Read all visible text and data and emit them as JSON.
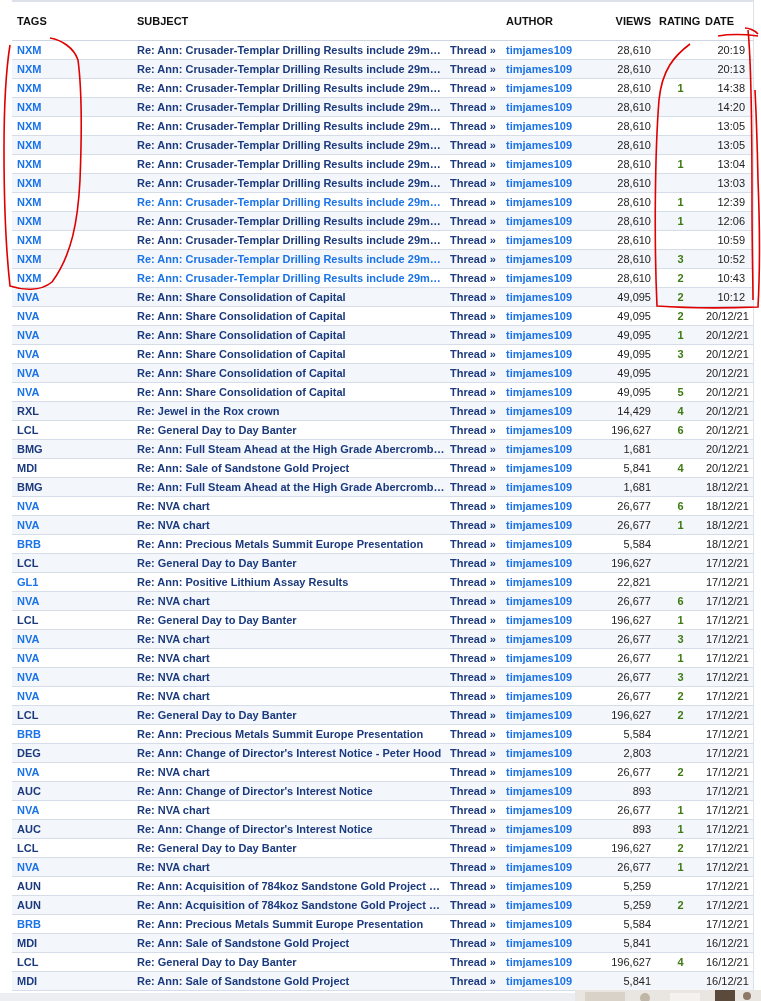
{
  "columns": [
    "TAGS",
    "SUBJECT",
    "AUTHOR",
    "VIEWS",
    "RATING",
    "DATE"
  ],
  "rows": [
    {
      "tag": "NXM",
      "tag_visited": false,
      "subject": "Re: Ann: Crusader-Templar Drilling Results include 29m…",
      "subject_visited": true,
      "thread": "Thread »",
      "author": "timjames109",
      "views": "28,610",
      "date": "20:19"
    },
    {
      "tag": "NXM",
      "tag_visited": false,
      "subject": "Re: Ann: Crusader-Templar Drilling Results include 29m…",
      "subject_visited": true,
      "thread": "Thread »",
      "author": "timjames109",
      "views": "28,610",
      "date": "20:13"
    },
    {
      "tag": "NXM",
      "tag_visited": false,
      "subject": "Re: Ann: Crusader-Templar Drilling Results include 29m…",
      "subject_visited": true,
      "thread": "Thread »",
      "author": "timjames109",
      "views": "28,610",
      "rating": "1",
      "date": "14:38"
    },
    {
      "tag": "NXM",
      "tag_visited": false,
      "subject": "Re: Ann: Crusader-Templar Drilling Results include 29m…",
      "subject_visited": true,
      "thread": "Thread »",
      "author": "timjames109",
      "views": "28,610",
      "date": "14:20"
    },
    {
      "tag": "NXM",
      "tag_visited": false,
      "subject": "Re: Ann: Crusader-Templar Drilling Results include 29m…",
      "subject_visited": true,
      "thread": "Thread »",
      "author": "timjames109",
      "views": "28,610",
      "date": "13:05"
    },
    {
      "tag": "NXM",
      "tag_visited": false,
      "subject": "Re: Ann: Crusader-Templar Drilling Results include 29m…",
      "subject_visited": true,
      "thread": "Thread »",
      "author": "timjames109",
      "views": "28,610",
      "date": "13:05"
    },
    {
      "tag": "NXM",
      "tag_visited": false,
      "subject": "Re: Ann: Crusader-Templar Drilling Results include 29m…",
      "subject_visited": true,
      "thread": "Thread »",
      "author": "timjames109",
      "views": "28,610",
      "rating": "1",
      "date": "13:04"
    },
    {
      "tag": "NXM",
      "tag_visited": false,
      "subject": "Re: Ann: Crusader-Templar Drilling Results include 29m…",
      "subject_visited": true,
      "thread": "Thread »",
      "author": "timjames109",
      "views": "28,610",
      "date": "13:03"
    },
    {
      "tag": "NXM",
      "tag_visited": false,
      "subject": "Re: Ann: Crusader-Templar Drilling Results include 29m…",
      "subject_visited": false,
      "thread": "Thread »",
      "author": "timjames109",
      "views": "28,610",
      "rating": "1",
      "date": "12:39"
    },
    {
      "tag": "NXM",
      "tag_visited": false,
      "subject": "Re: Ann: Crusader-Templar Drilling Results include 29m…",
      "subject_visited": true,
      "thread": "Thread »",
      "author": "timjames109",
      "views": "28,610",
      "rating": "1",
      "date": "12:06"
    },
    {
      "tag": "NXM",
      "tag_visited": false,
      "subject": "Re: Ann: Crusader-Templar Drilling Results include 29m…",
      "subject_visited": true,
      "thread": "Thread »",
      "author": "timjames109",
      "views": "28,610",
      "date": "10:59"
    },
    {
      "tag": "NXM",
      "tag_visited": false,
      "subject": "Re: Ann: Crusader-Templar Drilling Results include 29m…",
      "subject_visited": false,
      "thread": "Thread »",
      "author": "timjames109",
      "views": "28,610",
      "rating": "3",
      "date": "10:52"
    },
    {
      "tag": "NXM",
      "tag_visited": false,
      "subject": "Re: Ann: Crusader-Templar Drilling Results include 29m…",
      "subject_visited": false,
      "thread": "Thread »",
      "author": "timjames109",
      "views": "28,610",
      "rating": "2",
      "date": "10:43"
    },
    {
      "tag": "NVA",
      "tag_visited": false,
      "subject": "Re: Ann: Share Consolidation of Capital",
      "subject_visited": true,
      "thread": "Thread »",
      "author": "timjames109",
      "views": "49,095",
      "rating": "2",
      "date": "10:12"
    },
    {
      "tag": "NVA",
      "tag_visited": false,
      "subject": "Re: Ann: Share Consolidation of Capital",
      "subject_visited": true,
      "thread": "Thread »",
      "author": "timjames109",
      "views": "49,095",
      "rating": "2",
      "date": "20/12/21"
    },
    {
      "tag": "NVA",
      "tag_visited": false,
      "subject": "Re: Ann: Share Consolidation of Capital",
      "subject_visited": true,
      "thread": "Thread »",
      "author": "timjames109",
      "views": "49,095",
      "rating": "1",
      "date": "20/12/21"
    },
    {
      "tag": "NVA",
      "tag_visited": false,
      "subject": "Re: Ann: Share Consolidation of Capital",
      "subject_visited": true,
      "thread": "Thread »",
      "author": "timjames109",
      "views": "49,095",
      "rating": "3",
      "date": "20/12/21"
    },
    {
      "tag": "NVA",
      "tag_visited": false,
      "subject": "Re: Ann: Share Consolidation of Capital",
      "subject_visited": true,
      "thread": "Thread »",
      "author": "timjames109",
      "views": "49,095",
      "date": "20/12/21"
    },
    {
      "tag": "NVA",
      "tag_visited": false,
      "subject": "Re: Ann: Share Consolidation of Capital",
      "subject_visited": true,
      "thread": "Thread »",
      "author": "timjames109",
      "views": "49,095",
      "rating": "5",
      "date": "20/12/21"
    },
    {
      "tag": "RXL",
      "tag_visited": true,
      "subject": "Re: Jewel in the Rox crown",
      "subject_visited": true,
      "thread": "Thread »",
      "author": "timjames109",
      "views": "14,429",
      "rating": "4",
      "date": "20/12/21"
    },
    {
      "tag": "LCL",
      "tag_visited": true,
      "subject": "Re: General Day to Day Banter",
      "subject_visited": true,
      "thread": "Thread »",
      "author": "timjames109",
      "views": "196,627",
      "rating": "6",
      "date": "20/12/21"
    },
    {
      "tag": "BMG",
      "tag_visited": true,
      "subject": "Re: Ann: Full Steam Ahead at the High Grade Abercromb…",
      "subject_visited": true,
      "thread": "Thread »",
      "author": "timjames109",
      "views": "1,681",
      "date": "20/12/21"
    },
    {
      "tag": "MDI",
      "tag_visited": true,
      "subject": "Re: Ann: Sale of Sandstone Gold Project",
      "subject_visited": true,
      "thread": "Thread »",
      "author": "timjames109",
      "views": "5,841",
      "rating": "4",
      "date": "20/12/21"
    },
    {
      "tag": "BMG",
      "tag_visited": true,
      "subject": "Re: Ann: Full Steam Ahead at the High Grade Abercromb…",
      "subject_visited": true,
      "thread": "Thread »",
      "author": "timjames109",
      "views": "1,681",
      "date": "18/12/21"
    },
    {
      "tag": "NVA",
      "tag_visited": false,
      "subject": "Re: NVA chart",
      "subject_visited": true,
      "thread": "Thread »",
      "author": "timjames109",
      "views": "26,677",
      "rating": "6",
      "date": "18/12/21"
    },
    {
      "tag": "NVA",
      "tag_visited": false,
      "subject": "Re: NVA chart",
      "subject_visited": true,
      "thread": "Thread »",
      "author": "timjames109",
      "views": "26,677",
      "rating": "1",
      "date": "18/12/21"
    },
    {
      "tag": "BRB",
      "tag_visited": false,
      "subject": "Re: Ann: Precious Metals Summit Europe Presentation",
      "subject_visited": true,
      "thread": "Thread »",
      "author": "timjames109",
      "views": "5,584",
      "date": "18/12/21"
    },
    {
      "tag": "LCL",
      "tag_visited": true,
      "subject": "Re: General Day to Day Banter",
      "subject_visited": true,
      "thread": "Thread »",
      "author": "timjames109",
      "views": "196,627",
      "date": "17/12/21"
    },
    {
      "tag": "GL1",
      "tag_visited": false,
      "subject": "Re: Ann: Positive Lithium Assay Results",
      "subject_visited": true,
      "thread": "Thread »",
      "author": "timjames109",
      "views": "22,821",
      "date": "17/12/21"
    },
    {
      "tag": "NVA",
      "tag_visited": false,
      "subject": "Re: NVA chart",
      "subject_visited": true,
      "thread": "Thread »",
      "author": "timjames109",
      "views": "26,677",
      "rating": "6",
      "date": "17/12/21"
    },
    {
      "tag": "LCL",
      "tag_visited": true,
      "subject": "Re: General Day to Day Banter",
      "subject_visited": true,
      "thread": "Thread »",
      "author": "timjames109",
      "views": "196,627",
      "rating": "1",
      "date": "17/12/21"
    },
    {
      "tag": "NVA",
      "tag_visited": false,
      "subject": "Re: NVA chart",
      "subject_visited": true,
      "thread": "Thread »",
      "author": "timjames109",
      "views": "26,677",
      "rating": "3",
      "date": "17/12/21"
    },
    {
      "tag": "NVA",
      "tag_visited": false,
      "subject": "Re: NVA chart",
      "subject_visited": true,
      "thread": "Thread »",
      "author": "timjames109",
      "views": "26,677",
      "rating": "1",
      "date": "17/12/21"
    },
    {
      "tag": "NVA",
      "tag_visited": false,
      "subject": "Re: NVA chart",
      "subject_visited": true,
      "thread": "Thread »",
      "author": "timjames109",
      "views": "26,677",
      "rating": "3",
      "date": "17/12/21"
    },
    {
      "tag": "NVA",
      "tag_visited": false,
      "subject": "Re: NVA chart",
      "subject_visited": true,
      "thread": "Thread »",
      "author": "timjames109",
      "views": "26,677",
      "rating": "2",
      "date": "17/12/21"
    },
    {
      "tag": "LCL",
      "tag_visited": true,
      "subject": "Re: General Day to Day Banter",
      "subject_visited": true,
      "thread": "Thread »",
      "author": "timjames109",
      "views": "196,627",
      "rating": "2",
      "date": "17/12/21"
    },
    {
      "tag": "BRB",
      "tag_visited": false,
      "subject": "Re: Ann: Precious Metals Summit Europe Presentation",
      "subject_visited": true,
      "thread": "Thread »",
      "author": "timjames109",
      "views": "5,584",
      "date": "17/12/21"
    },
    {
      "tag": "DEG",
      "tag_visited": true,
      "subject": "Re: Ann: Change of Director's Interest Notice - Peter Hood",
      "subject_visited": true,
      "thread": "Thread »",
      "author": "timjames109",
      "views": "2,803",
      "date": "17/12/21"
    },
    {
      "tag": "NVA",
      "tag_visited": false,
      "subject": "Re: NVA chart",
      "subject_visited": true,
      "thread": "Thread »",
      "author": "timjames109",
      "views": "26,677",
      "rating": "2",
      "date": "17/12/21"
    },
    {
      "tag": "AUC",
      "tag_visited": true,
      "subject": "Re: Ann: Change of Director's Interest Notice",
      "subject_visited": true,
      "thread": "Thread »",
      "author": "timjames109",
      "views": "893",
      "date": "17/12/21"
    },
    {
      "tag": "NVA",
      "tag_visited": false,
      "subject": "Re: NVA chart",
      "subject_visited": true,
      "thread": "Thread »",
      "author": "timjames109",
      "views": "26,677",
      "rating": "1",
      "date": "17/12/21"
    },
    {
      "tag": "AUC",
      "tag_visited": true,
      "subject": "Re: Ann: Change of Director's Interest Notice",
      "subject_visited": true,
      "thread": "Thread »",
      "author": "timjames109",
      "views": "893",
      "rating": "1",
      "date": "17/12/21"
    },
    {
      "tag": "LCL",
      "tag_visited": true,
      "subject": "Re: General Day to Day Banter",
      "subject_visited": true,
      "thread": "Thread »",
      "author": "timjames109",
      "views": "196,627",
      "rating": "2",
      "date": "17/12/21"
    },
    {
      "tag": "NVA",
      "tag_visited": false,
      "subject": "Re: NVA chart",
      "subject_visited": true,
      "thread": "Thread »",
      "author": "timjames109",
      "views": "26,677",
      "rating": "1",
      "date": "17/12/21"
    },
    {
      "tag": "AUN",
      "tag_visited": true,
      "subject": "Re: Ann: Acquisition of 784koz Sandstone Gold Project …",
      "subject_visited": true,
      "thread": "Thread »",
      "author": "timjames109",
      "views": "5,259",
      "date": "17/12/21"
    },
    {
      "tag": "AUN",
      "tag_visited": true,
      "subject": "Re: Ann: Acquisition of 784koz Sandstone Gold Project …",
      "subject_visited": true,
      "thread": "Thread »",
      "author": "timjames109",
      "views": "5,259",
      "rating": "2",
      "date": "17/12/21"
    },
    {
      "tag": "BRB",
      "tag_visited": false,
      "subject": "Re: Ann: Precious Metals Summit Europe Presentation",
      "subject_visited": true,
      "thread": "Thread »",
      "author": "timjames109",
      "views": "5,584",
      "date": "17/12/21"
    },
    {
      "tag": "MDI",
      "tag_visited": true,
      "subject": "Re: Ann: Sale of Sandstone Gold Project",
      "subject_visited": true,
      "thread": "Thread »",
      "author": "timjames109",
      "views": "5,841",
      "date": "16/12/21"
    },
    {
      "tag": "LCL",
      "tag_visited": true,
      "subject": "Re: General Day to Day Banter",
      "subject_visited": true,
      "thread": "Thread »",
      "author": "timjames109",
      "views": "196,627",
      "rating": "4",
      "date": "16/12/21"
    },
    {
      "tag": "MDI",
      "tag_visited": true,
      "subject": "Re: Ann: Sale of Sandstone Gold Project",
      "subject_visited": true,
      "thread": "Thread »",
      "author": "timjames109",
      "views": "5,841",
      "date": "16/12/21"
    }
  ]
}
